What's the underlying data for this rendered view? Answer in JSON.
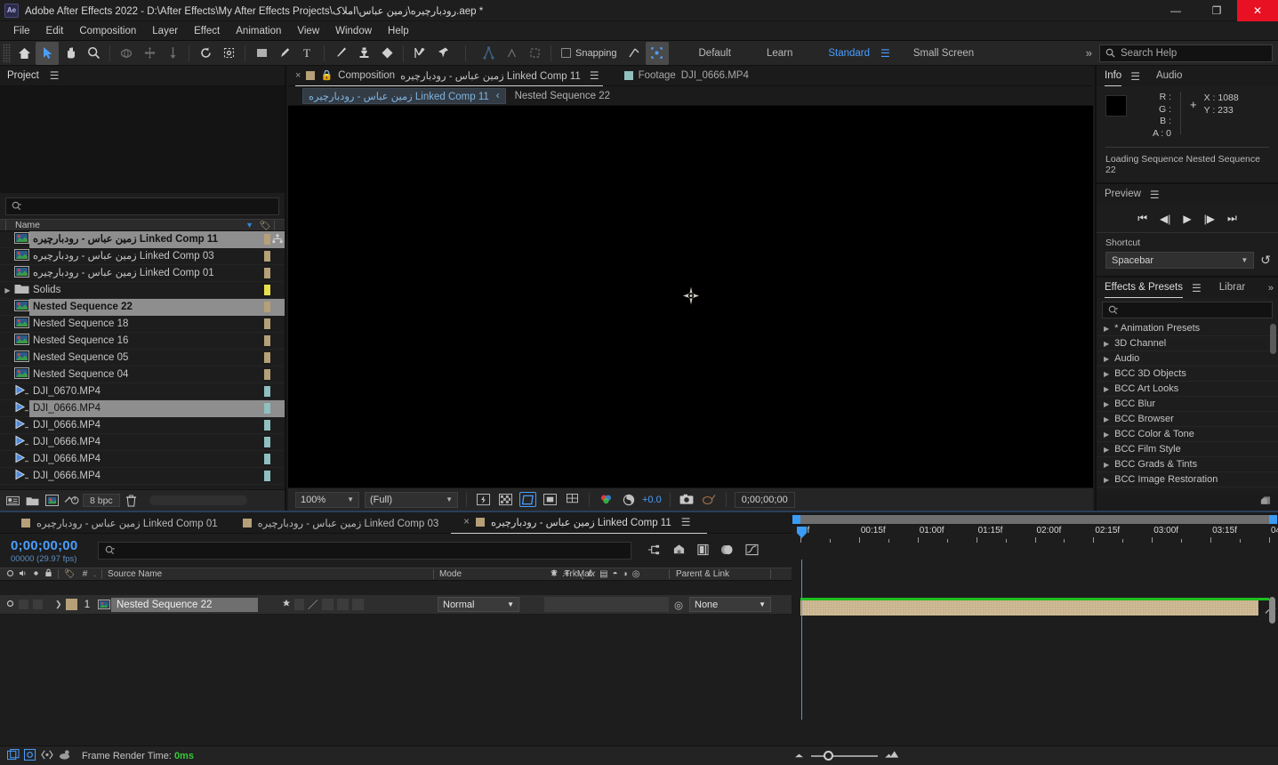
{
  "titlebar": {
    "app_title": "Adobe After Effects 2022 - D:\\After Effects\\My After Effects Projects\\رودبارچیره\\زمین عباس\\املاک.aep *",
    "logo": "Ae",
    "minimize": "—",
    "maximize": "❐",
    "close": "✕"
  },
  "menubar": {
    "items": [
      "File",
      "Edit",
      "Composition",
      "Layer",
      "Effect",
      "Animation",
      "View",
      "Window",
      "Help"
    ]
  },
  "toolbar": {
    "snapping_label": "Snapping",
    "workspaces": [
      "Default",
      "Learn",
      "Standard",
      "Small Screen"
    ],
    "active_workspace": "Standard",
    "overflow": "»",
    "search_help_placeholder": "Search Help",
    "tools": [
      "home-icon",
      "selection-tool-icon",
      "hand-tool-icon",
      "zoom-tool-icon",
      "orbit-tool-icon",
      "pan-tool-icon",
      "dolly-tool-icon",
      "rotation-tool-icon",
      "anchor-point-tool-icon",
      "shape-tool-icon",
      "pen-tool-icon",
      "type-tool-icon",
      "brush-tool-icon",
      "clone-stamp-tool-icon",
      "eraser-tool-icon",
      "roto-brush-tool-icon",
      "puppet-pin-tool-icon"
    ]
  },
  "project": {
    "tab_label": "Project",
    "search_placeholder": "",
    "column_name": "Name",
    "bpc_label": "8 bpc",
    "items": [
      {
        "name": "زمین عباس - رودبارچیره Linked Comp 11",
        "type": "comp",
        "color": "#b5a077",
        "selected": true,
        "bold": true,
        "indent": 0,
        "has_disclosure": false
      },
      {
        "name": "زمین عباس - رودبارچیره Linked Comp 03",
        "type": "comp",
        "color": "#b5a077",
        "selected": false,
        "indent": 0,
        "has_disclosure": false
      },
      {
        "name": "زمین عباس - رودبارچیره Linked Comp 01",
        "type": "comp",
        "color": "#b5a077",
        "selected": false,
        "indent": 0,
        "has_disclosure": false
      },
      {
        "name": "Solids",
        "type": "folder",
        "color": "#e8e04a",
        "selected": false,
        "indent": 0,
        "has_disclosure": true
      },
      {
        "name": "Nested Sequence 22",
        "type": "comp",
        "color": "#b5a077",
        "selected": true,
        "bold": true,
        "indent": 0,
        "has_disclosure": false
      },
      {
        "name": "Nested Sequence 18",
        "type": "comp",
        "color": "#b5a077",
        "selected": false,
        "indent": 0,
        "has_disclosure": false
      },
      {
        "name": "Nested Sequence 16",
        "type": "comp",
        "color": "#b5a077",
        "selected": false,
        "indent": 0,
        "has_disclosure": false
      },
      {
        "name": "Nested Sequence 05",
        "type": "comp",
        "color": "#b5a077",
        "selected": false,
        "indent": 0,
        "has_disclosure": false
      },
      {
        "name": "Nested Sequence 04",
        "type": "comp",
        "color": "#b5a077",
        "selected": false,
        "indent": 0,
        "has_disclosure": false
      },
      {
        "name": "DJI_0670.MP4",
        "type": "video",
        "color": "#8fbfbf",
        "selected": false,
        "indent": 0,
        "has_disclosure": false
      },
      {
        "name": "DJI_0666.MP4",
        "type": "video",
        "color": "#8fbfbf",
        "selected": true,
        "bold": false,
        "indent": 0,
        "has_disclosure": false
      },
      {
        "name": "DJI_0666.MP4",
        "type": "video",
        "color": "#8fbfbf",
        "selected": false,
        "indent": 0,
        "has_disclosure": false
      },
      {
        "name": "DJI_0666.MP4",
        "type": "video",
        "color": "#8fbfbf",
        "selected": false,
        "indent": 0,
        "has_disclosure": false
      },
      {
        "name": "DJI_0666.MP4",
        "type": "video",
        "color": "#8fbfbf",
        "selected": false,
        "indent": 0,
        "has_disclosure": false
      },
      {
        "name": "DJI_0666.MP4",
        "type": "video",
        "color": "#8fbfbf",
        "selected": false,
        "indent": 0,
        "has_disclosure": false
      }
    ]
  },
  "composition": {
    "close_x": "×",
    "tab_prefix": "Composition",
    "tab_title": "زمین عباس - رودبارچیره Linked Comp 11",
    "footage_prefix": "Footage",
    "footage_name": "DJI_0666.MP4",
    "breadcrumb_chip": "زمین عباس - رودبارچیره Linked Comp 11",
    "breadcrumb_arrow": "‹",
    "breadcrumb_rest": "Nested Sequence 22",
    "bottom": {
      "magnification": "100%",
      "resolution": "(Full)",
      "exposure": "+0.0",
      "timecode": "0;00;00;00"
    }
  },
  "info_panel": {
    "tabs": [
      "Info",
      "Audio"
    ],
    "active_tab": "Info",
    "r_label": "R :",
    "g_label": "G :",
    "b_label": "B :",
    "a_label": "A :",
    "a_value": "0",
    "x_label": "X : 1088",
    "y_label": "Y : 233",
    "status": "Loading Sequence Nested Sequence 22"
  },
  "preview_panel": {
    "title": "Preview",
    "shortcut_label": "Shortcut",
    "shortcut_value": "Spacebar",
    "buttons": [
      "first-frame-icon",
      "prev-frame-icon",
      "play-icon",
      "next-frame-icon",
      "last-frame-icon"
    ]
  },
  "effects_panel": {
    "tabs": [
      "Effects & Presets",
      "Librar"
    ],
    "active_tab": "Effects & Presets",
    "overflow": "»",
    "search_placeholder": "",
    "categories": [
      "* Animation Presets",
      "3D Channel",
      "Audio",
      "BCC 3D Objects",
      "BCC Art Looks",
      "BCC Blur",
      "BCC Browser",
      "BCC Color & Tone",
      "BCC Film Style",
      "BCC Grads & Tints",
      "BCC Image Restoration"
    ]
  },
  "timeline": {
    "tabs": [
      {
        "label": "زمین عباس - رودبارچیره Linked Comp 01",
        "active": false,
        "closable": false
      },
      {
        "label": "زمین عباس - رودبارچیره Linked Comp 03",
        "active": false,
        "closable": false
      },
      {
        "label": "زمین عباس - رودبارچیره Linked Comp 11",
        "active": true,
        "closable": true
      }
    ],
    "close_x": "×",
    "current_time": "0;00;00;00",
    "frame_info": "00000 (29.97 fps)",
    "search_placeholder": "",
    "columns": {
      "source_name": "Source Name",
      "mode": "Mode",
      "t": "T",
      "trkmat": "TrkMat",
      "parent_link": "Parent & Link",
      "hash": "#"
    },
    "layers": [
      {
        "index": "1",
        "source_name": "Nested Sequence 22",
        "mode": "Normal",
        "parent": "None"
      }
    ],
    "ruler_ticks": [
      "0f",
      "00:15f",
      "01:00f",
      "01:15f",
      "02:00f",
      "02:15f",
      "03:00f",
      "03:15f",
      "04"
    ],
    "status_label": "Frame Render Time:",
    "status_value": "0ms"
  },
  "colors": {
    "accent_blue": "#4a9eff",
    "comp_swatch": "#b5a077",
    "footage_swatch": "#8fbfbf",
    "solids_swatch": "#e8e04a",
    "render_green": "#37c837",
    "close_red": "#e81123"
  }
}
